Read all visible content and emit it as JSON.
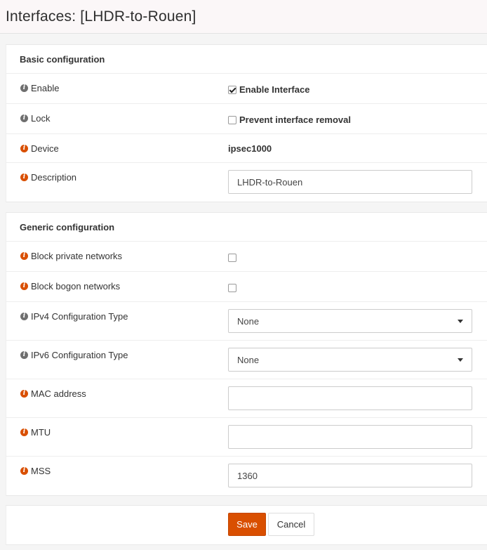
{
  "page": {
    "title": "Interfaces: [LHDR-to-Rouen]"
  },
  "basic": {
    "heading": "Basic configuration",
    "enable": {
      "label": "Enable",
      "checkbox_label": "Enable Interface",
      "checked": true
    },
    "lock": {
      "label": "Lock",
      "checkbox_label": "Prevent interface removal",
      "checked": false
    },
    "device": {
      "label": "Device",
      "value": "ipsec1000"
    },
    "description": {
      "label": "Description",
      "value": "LHDR-to-Rouen"
    }
  },
  "generic": {
    "heading": "Generic configuration",
    "block_private": {
      "label": "Block private networks",
      "checked": false
    },
    "block_bogon": {
      "label": "Block bogon networks",
      "checked": false
    },
    "ipv4_type": {
      "label": "IPv4 Configuration Type",
      "value": "None"
    },
    "ipv6_type": {
      "label": "IPv6 Configuration Type",
      "value": "None"
    },
    "mac": {
      "label": "MAC address",
      "value": ""
    },
    "mtu": {
      "label": "MTU",
      "value": ""
    },
    "mss": {
      "label": "MSS",
      "value": "1360"
    }
  },
  "actions": {
    "save_label": "Save",
    "cancel_label": "Cancel"
  },
  "colors": {
    "accent": "#d94f00",
    "info_grey": "#6f6f6f"
  }
}
